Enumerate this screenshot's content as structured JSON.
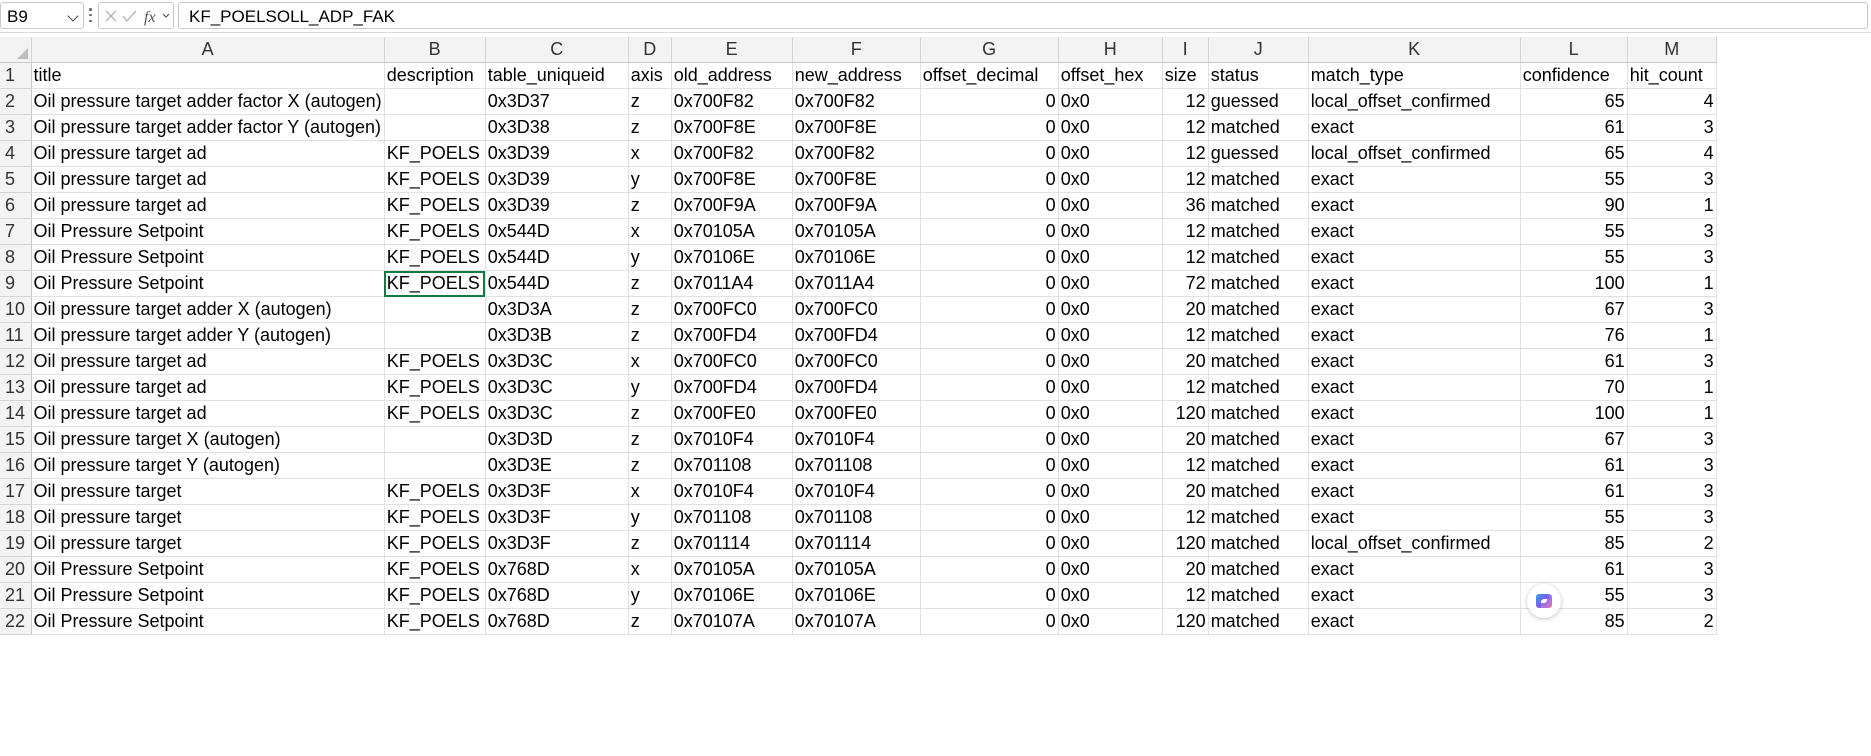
{
  "name_box": "B9",
  "formula_content": "KF_POELSOLL_ADP_FAK",
  "icons": [
    "cancel-icon",
    "check-icon",
    "fx-icon",
    "chevron-down-icon",
    "copilot-icon"
  ],
  "column_letters": [
    "A",
    "B",
    "C",
    "D",
    "E",
    "F",
    "G",
    "H",
    "I",
    "J",
    "K",
    "L",
    "M"
  ],
  "rows": [
    {
      "n": "1",
      "c": [
        "title",
        "description",
        "table_uniqueid",
        "axis",
        "old_address",
        "new_address",
        "offset_decimal",
        "offset_hex",
        "size",
        "status",
        "match_type",
        "confidence",
        "hit_count"
      ]
    },
    {
      "n": "2",
      "c": [
        "Oil pressure target adder factor X (autogen)",
        "",
        "0x3D37",
        "z",
        "0x700F82",
        "0x700F82",
        "0",
        "0x0",
        "12",
        "guessed",
        "local_offset_confirmed",
        "65",
        "4"
      ]
    },
    {
      "n": "3",
      "c": [
        "Oil pressure target adder factor Y (autogen)",
        "",
        "0x3D38",
        "z",
        "0x700F8E",
        "0x700F8E",
        "0",
        "0x0",
        "12",
        "matched",
        "exact",
        "61",
        "3"
      ]
    },
    {
      "n": "4",
      "c": [
        "Oil pressure target ad",
        "KF_POELS",
        "0x3D39",
        "x",
        "0x700F82",
        "0x700F82",
        "0",
        "0x0",
        "12",
        "guessed",
        "local_offset_confirmed",
        "65",
        "4"
      ]
    },
    {
      "n": "5",
      "c": [
        "Oil pressure target ad",
        "KF_POELS",
        "0x3D39",
        "y",
        "0x700F8E",
        "0x700F8E",
        "0",
        "0x0",
        "12",
        "matched",
        "exact",
        "55",
        "3"
      ]
    },
    {
      "n": "6",
      "c": [
        "Oil pressure target ad",
        "KF_POELS",
        "0x3D39",
        "z",
        "0x700F9A",
        "0x700F9A",
        "0",
        "0x0",
        "36",
        "matched",
        "exact",
        "90",
        "1"
      ]
    },
    {
      "n": "7",
      "c": [
        "Oil Pressure Setpoint",
        "KF_POELS",
        "0x544D",
        "x",
        "0x70105A",
        "0x70105A",
        "0",
        "0x0",
        "12",
        "matched",
        "exact",
        "55",
        "3"
      ]
    },
    {
      "n": "8",
      "c": [
        "Oil Pressure Setpoint",
        "KF_POELS",
        "0x544D",
        "y",
        "0x70106E",
        "0x70106E",
        "0",
        "0x0",
        "12",
        "matched",
        "exact",
        "55",
        "3"
      ]
    },
    {
      "n": "9",
      "c": [
        "Oil Pressure Setpoint",
        "KF_POELS",
        "0x544D",
        "z",
        "0x7011A4",
        "0x7011A4",
        "0",
        "0x0",
        "72",
        "matched",
        "exact",
        "100",
        "1"
      ]
    },
    {
      "n": "10",
      "c": [
        "Oil pressure target adder X (autogen)",
        "",
        "0x3D3A",
        "z",
        "0x700FC0",
        "0x700FC0",
        "0",
        "0x0",
        "20",
        "matched",
        "exact",
        "67",
        "3"
      ]
    },
    {
      "n": "11",
      "c": [
        "Oil pressure target adder Y (autogen)",
        "",
        "0x3D3B",
        "z",
        "0x700FD4",
        "0x700FD4",
        "0",
        "0x0",
        "12",
        "matched",
        "exact",
        "76",
        "1"
      ]
    },
    {
      "n": "12",
      "c": [
        "Oil pressure target ad",
        "KF_POELS",
        "0x3D3C",
        "x",
        "0x700FC0",
        "0x700FC0",
        "0",
        "0x0",
        "20",
        "matched",
        "exact",
        "61",
        "3"
      ]
    },
    {
      "n": "13",
      "c": [
        "Oil pressure target ad",
        "KF_POELS",
        "0x3D3C",
        "y",
        "0x700FD4",
        "0x700FD4",
        "0",
        "0x0",
        "12",
        "matched",
        "exact",
        "70",
        "1"
      ]
    },
    {
      "n": "14",
      "c": [
        "Oil pressure target ad",
        "KF_POELS",
        "0x3D3C",
        "z",
        "0x700FE0",
        "0x700FE0",
        "0",
        "0x0",
        "120",
        "matched",
        "exact",
        "100",
        "1"
      ]
    },
    {
      "n": "15",
      "c": [
        "Oil pressure target X (autogen)",
        "",
        "0x3D3D",
        "z",
        "0x7010F4",
        "0x7010F4",
        "0",
        "0x0",
        "20",
        "matched",
        "exact",
        "67",
        "3"
      ]
    },
    {
      "n": "16",
      "c": [
        "Oil pressure target Y (autogen)",
        "",
        "0x3D3E",
        "z",
        "0x701108",
        "0x701108",
        "0",
        "0x0",
        "12",
        "matched",
        "exact",
        "61",
        "3"
      ]
    },
    {
      "n": "17",
      "c": [
        "Oil pressure target",
        "KF_POELS",
        "0x3D3F",
        "x",
        "0x7010F4",
        "0x7010F4",
        "0",
        "0x0",
        "20",
        "matched",
        "exact",
        "61",
        "3"
      ]
    },
    {
      "n": "18",
      "c": [
        "Oil pressure target",
        "KF_POELS",
        "0x3D3F",
        "y",
        "0x701108",
        "0x701108",
        "0",
        "0x0",
        "12",
        "matched",
        "exact",
        "55",
        "3"
      ]
    },
    {
      "n": "19",
      "c": [
        "Oil pressure target",
        "KF_POELS",
        "0x3D3F",
        "z",
        "0x701114",
        "0x701114",
        "0",
        "0x0",
        "120",
        "matched",
        "local_offset_confirmed",
        "85",
        "2"
      ]
    },
    {
      "n": "20",
      "c": [
        "Oil Pressure Setpoint",
        "KF_POELS",
        "0x768D",
        "x",
        "0x70105A",
        "0x70105A",
        "0",
        "0x0",
        "20",
        "matched",
        "exact",
        "61",
        "3"
      ]
    },
    {
      "n": "21",
      "c": [
        "Oil Pressure Setpoint",
        "KF_POELS",
        "0x768D",
        "y",
        "0x70106E",
        "0x70106E",
        "0",
        "0x0",
        "12",
        "matched",
        "exact",
        "55",
        "3"
      ]
    },
    {
      "n": "22",
      "c": [
        "Oil Pressure Setpoint",
        "KF_POELS",
        "0x768D",
        "z",
        "0x70107A",
        "0x70107A",
        "0",
        "0x0",
        "120",
        "matched",
        "exact",
        "85",
        "2"
      ]
    }
  ]
}
